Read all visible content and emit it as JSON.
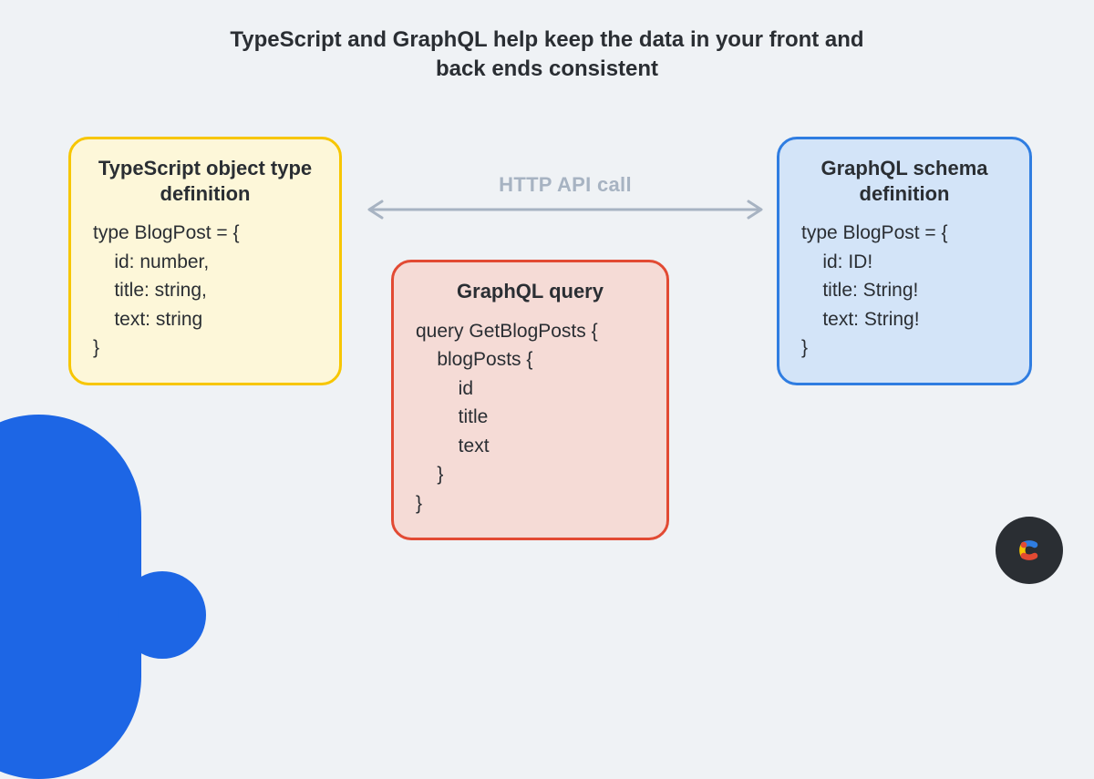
{
  "title": "TypeScript and GraphQL help keep the data in your\nfront and back ends consistent",
  "arrow_label": "HTTP API call",
  "ts_box": {
    "heading": "TypeScript object\ntype definition",
    "code": "type BlogPost = {\n    id: number,\n    title: string,\n    text: string\n}"
  },
  "schema_box": {
    "heading": "GraphQL schema\ndefinition",
    "code": "type BlogPost = {\n    id: ID!\n    title: String!\n    text: String!\n}"
  },
  "query_box": {
    "heading": "GraphQL query",
    "code": "query GetBlogPosts {\n    blogPosts {\n        id\n        title\n        text\n    }\n}"
  },
  "colors": {
    "ts_border": "#f7c600",
    "ts_fill": "#fdf7d9",
    "schema_border": "#2f7de1",
    "schema_fill": "#d3e4f8",
    "query_border": "#e24a33",
    "query_fill": "#f5dbd6",
    "arrow": "#a7b3c2",
    "deco": "#1d66e5"
  }
}
